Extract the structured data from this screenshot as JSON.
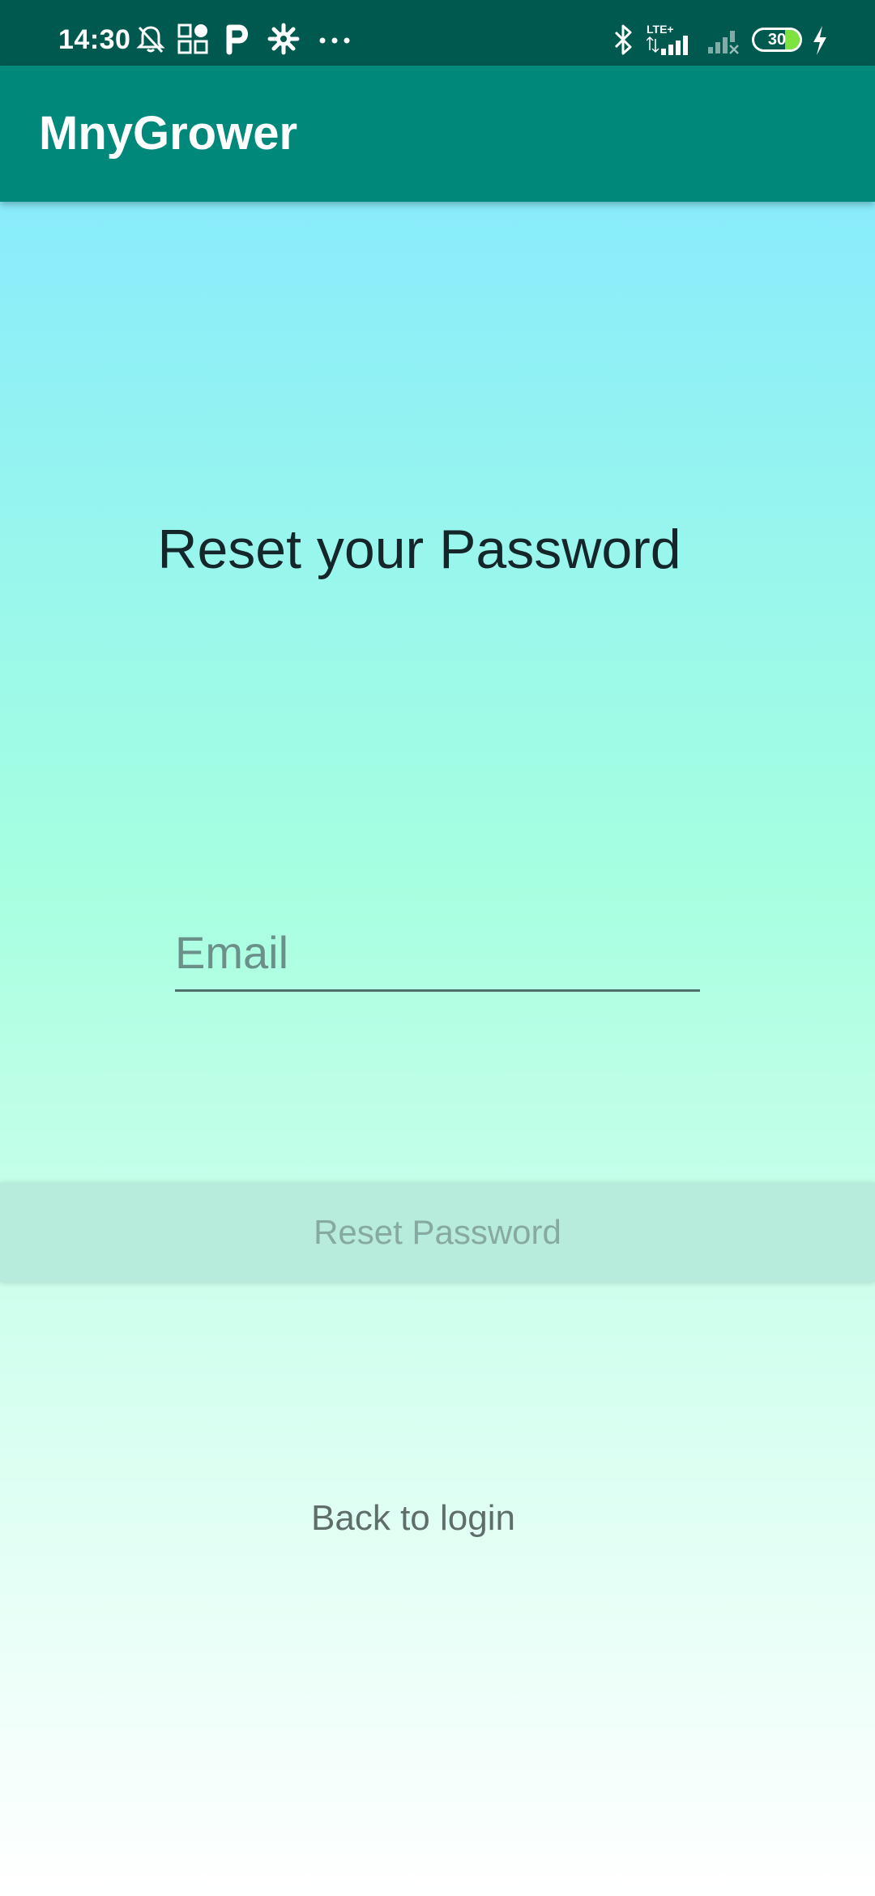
{
  "status_bar": {
    "time": "14:30",
    "left_icons": [
      "muted-bell-icon",
      "apps-icon",
      "parking-icon",
      "gear-flower-icon",
      "more-dots-icon"
    ],
    "network_label": "LTE+",
    "battery_level": "30",
    "right_icons": [
      "bluetooth-icon",
      "lte-signal-icon",
      "no-signal-icon",
      "battery-icon",
      "charging-icon"
    ]
  },
  "app_bar": {
    "title": "MnyGrower",
    "color": "#00897b"
  },
  "main": {
    "heading": "Reset your Password",
    "email_placeholder": "Email",
    "email_value": "",
    "reset_button_label": "Reset Password",
    "back_link_label": "Back to login"
  },
  "colors": {
    "status_bar": "#00594f",
    "gradient_top": "#89ecfb",
    "gradient_mid": "#a6ffe0",
    "gradient_bottom": "#ffffff",
    "button_bg": "#b7ebdb"
  }
}
